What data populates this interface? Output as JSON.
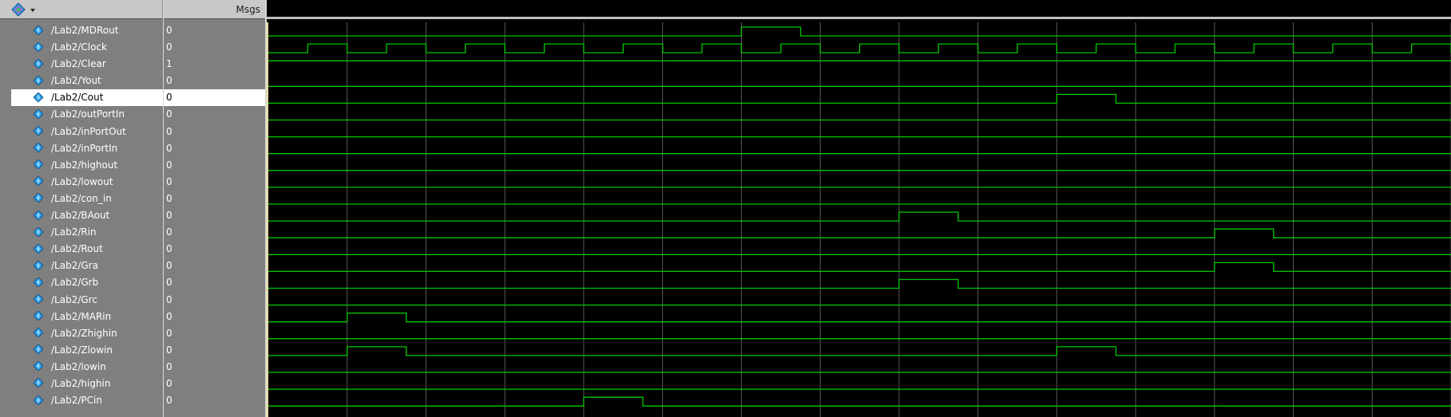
{
  "header": {
    "msgs_label": "Msgs",
    "menu_icon": "diamond-dropdown-icon"
  },
  "signals": [
    {
      "name": "/Lab2/MDRout",
      "value": "0",
      "pulses": [
        [
          6,
          6.75
        ]
      ]
    },
    {
      "name": "/Lab2/Clock",
      "value": "0",
      "clock": true
    },
    {
      "name": "/Lab2/Clear",
      "value": "1",
      "pulses": []
    },
    {
      "name": "/Lab2/Yout",
      "value": "0",
      "pulses": []
    },
    {
      "name": "/Lab2/Cout",
      "value": "0",
      "pulses": [
        [
          10,
          10.75
        ]
      ],
      "selected": true
    },
    {
      "name": "/Lab2/outPortIn",
      "value": "0",
      "pulses": []
    },
    {
      "name": "/Lab2/inPortOut",
      "value": "0",
      "pulses": []
    },
    {
      "name": "/Lab2/inPortIn",
      "value": "0",
      "pulses": []
    },
    {
      "name": "/Lab2/highout",
      "value": "0",
      "pulses": []
    },
    {
      "name": "/Lab2/lowout",
      "value": "0",
      "pulses": []
    },
    {
      "name": "/Lab2/con_in",
      "value": "0",
      "pulses": []
    },
    {
      "name": "/Lab2/BAout",
      "value": "0",
      "pulses": [
        [
          8,
          8.75
        ]
      ]
    },
    {
      "name": "/Lab2/Rin",
      "value": "0",
      "pulses": [
        [
          12,
          12.75
        ]
      ]
    },
    {
      "name": "/Lab2/Rout",
      "value": "0",
      "pulses": []
    },
    {
      "name": "/Lab2/Gra",
      "value": "0",
      "pulses": [
        [
          12,
          12.75
        ]
      ]
    },
    {
      "name": "/Lab2/Grb",
      "value": "0",
      "pulses": [
        [
          8,
          8.75
        ]
      ]
    },
    {
      "name": "/Lab2/Grc",
      "value": "0",
      "pulses": []
    },
    {
      "name": "/Lab2/MARin",
      "value": "0",
      "pulses": [
        [
          1,
          1.75
        ]
      ]
    },
    {
      "name": "/Lab2/Zhighin",
      "value": "0",
      "pulses": []
    },
    {
      "name": "/Lab2/Zlowin",
      "value": "0",
      "pulses": [
        [
          1,
          1.75
        ],
        [
          10,
          10.75
        ]
      ]
    },
    {
      "name": "/Lab2/lowin",
      "value": "0",
      "pulses": []
    },
    {
      "name": "/Lab2/highin",
      "value": "0",
      "pulses": []
    },
    {
      "name": "/Lab2/PCin",
      "value": "0",
      "pulses": [
        [
          4,
          4.75
        ]
      ]
    }
  ],
  "waveform": {
    "clock_periods": 15,
    "colors": {
      "trace": "#00c800",
      "grid": "#5a5a5a",
      "background": "#000000",
      "cursor": "#e8e0a0"
    }
  }
}
